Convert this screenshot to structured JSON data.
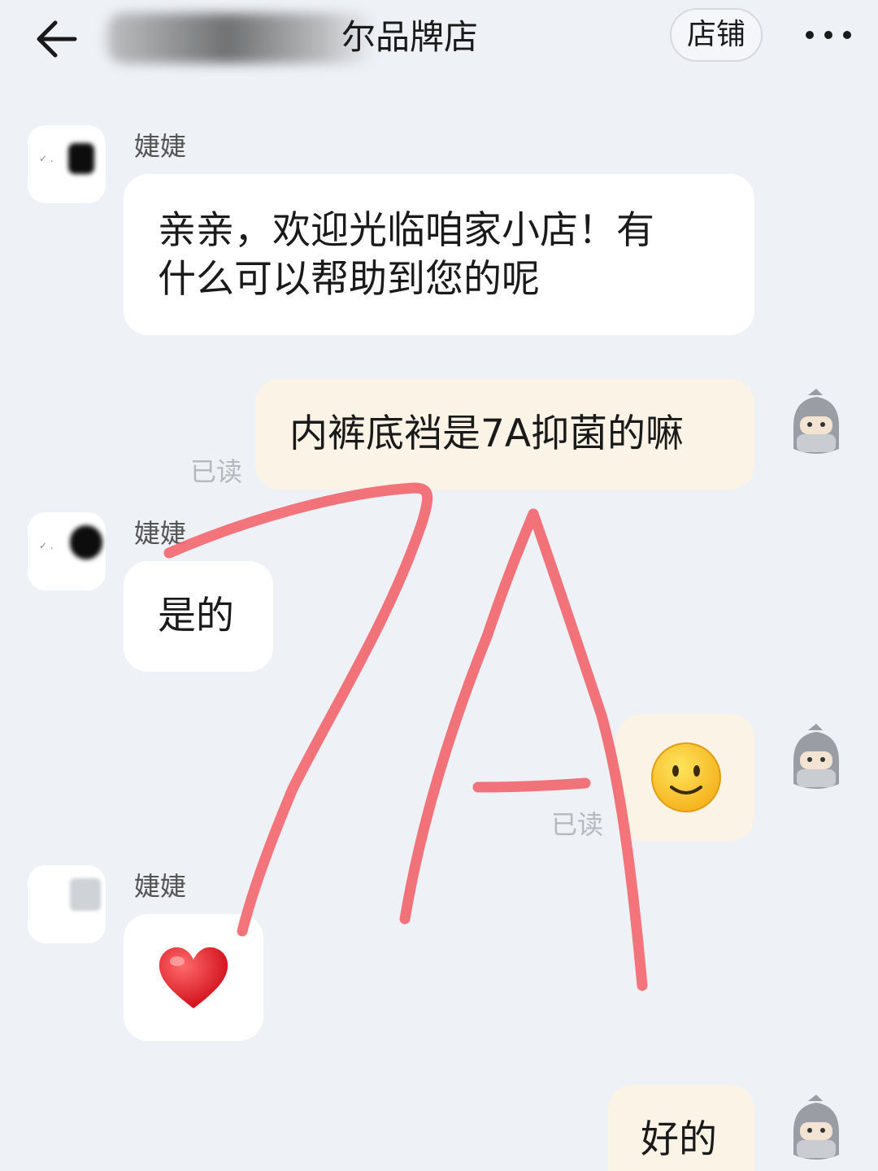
{
  "header": {
    "title_visible": "尔品牌店",
    "shop_button_label": "店铺",
    "back_icon": "back-arrow-icon",
    "more_icon": "more-dots-icon"
  },
  "messages": [
    {
      "direction": "incoming",
      "sender": "婕婕",
      "text_line1": "亲亲，欢迎光临咱家小店！有",
      "text_line2": "什么可以帮助到您的呢"
    },
    {
      "direction": "outgoing",
      "text": "内裤底裆是7A抑菌的嘛",
      "status": "已读"
    },
    {
      "direction": "incoming",
      "sender": "婕婕",
      "text": "是的"
    },
    {
      "direction": "outgoing",
      "emoji": "smile-emoji",
      "status": "已读"
    },
    {
      "direction": "incoming",
      "sender": "婕婕",
      "emoji": "heart-emoji"
    },
    {
      "direction": "outgoing",
      "text": "好的"
    }
  ],
  "overlay": {
    "annotation_text": "7A",
    "stroke_color": "#f26d73"
  },
  "colors": {
    "background": "#eef1f6",
    "incoming_bubble": "#ffffff",
    "outgoing_bubble": "#fbf4e6",
    "read_text": "#b5b8bd"
  }
}
